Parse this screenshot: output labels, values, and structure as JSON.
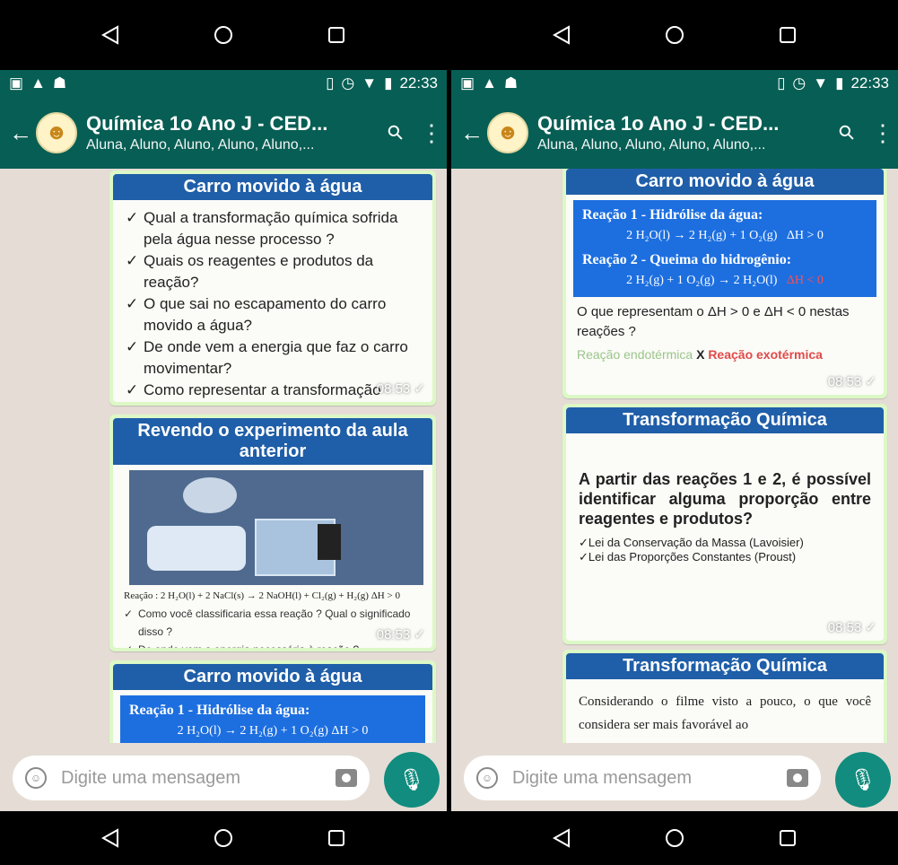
{
  "nav": {
    "back": "◁",
    "home": "○",
    "recents": "□"
  },
  "status": {
    "time": "22:33"
  },
  "chat": {
    "title": "Química 1o Ano J - CED...",
    "subtitle": "Aluna, Aluno, Aluno, Aluno, Aluno,...",
    "subtitle2": "Aluna, Aluno, Aluno, Aluno, Aluno,..."
  },
  "input": {
    "placeholder": "Digite uma mensagem"
  },
  "left": {
    "m1": {
      "header": "Carro movido à água",
      "bullets": [
        "Qual a transformação química sofrida pela água nesse processo ?",
        "Quais os reagentes e produtos da reação?",
        "O que sai no escapamento do carro movido a água?",
        "De onde vem a energia que faz o carro movimentar?",
        "Como representar a transformação química envolvida no processo?"
      ],
      "time": "08:53 ✓"
    },
    "m2": {
      "header": "Revendo o experimento da aula anterior",
      "equation": "Reação :   2 H₂O(l) + 2 NaCl(s) → 2 NaOH(l) + Cl₂(g) + H₂(g)   ΔH > 0",
      "bullets": [
        "Como você classificaria essa reação ? Qual o significado disso ?",
        "De onde vem a energia necessária à reação ?"
      ],
      "time": "08:53 ✓"
    },
    "m3": {
      "header": "Carro movido à água",
      "reaction1": "Reação 1 - Hidrólise da água:",
      "eq1": "2 H₂O(l) → 2 H₂(g) + 1 O₂(g)     ΔH > 0"
    }
  },
  "right": {
    "m1": {
      "header": "Carro movido à água",
      "reaction1": "Reação 1 - Hidrólise da água:",
      "eq1": "2 H₂O(l) → 2 H₂(g) + 1 O₂(g)",
      "dh1": "ΔH > 0",
      "reaction2": "Reação 2 - Queima do hidrogênio:",
      "eq2": "2 H₂(g) + 1 O₂(g) → 2 H₂O(l)",
      "dh2": "ΔH < 0",
      "question": "O que representam o ΔH > 0 e ΔH < 0 nestas reações ?",
      "ans_endo": "Reação endotérmica",
      "ans_x": " X ",
      "ans_exo": "Reação exotérmica",
      "time": "08:53 ✓"
    },
    "m2": {
      "header": "Transformação Química",
      "question": "A partir das reações 1 e 2, é possível identificar alguma proporção entre reagentes e produtos?",
      "law1": "✓Lei da Conservação da Massa (Lavoisier)",
      "law2": "✓Lei das Proporções Constantes (Proust)",
      "time": "08:53 ✓"
    },
    "m3": {
      "header": "Transformação Química",
      "text": "Considerando o filme visto a pouco, o que você considera ser mais favorável ao"
    }
  },
  "icons": {
    "back_arrow": "back-arrow-icon",
    "attach": "paperclip-icon",
    "menu": "more-vert-icon",
    "emoji": "emoji-icon",
    "camera": "camera-icon",
    "mic": "mic-icon"
  },
  "colors": {
    "whatsapp_header": "#075e54",
    "bubble": "#dcf8c6",
    "slide_header": "#1f5ea8",
    "mic": "#128c7e"
  }
}
